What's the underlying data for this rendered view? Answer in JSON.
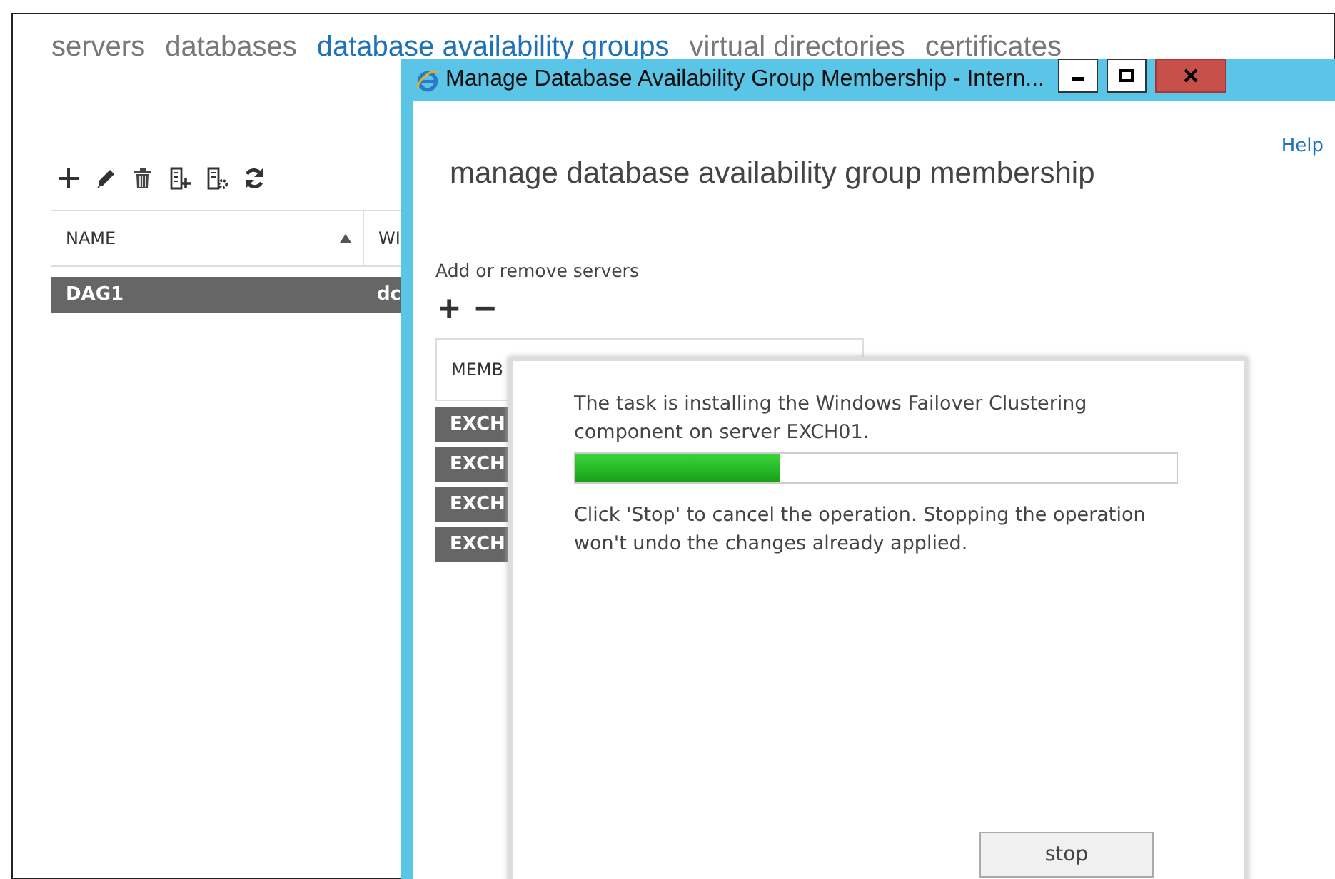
{
  "tabs": [
    {
      "label": "servers",
      "selected": false
    },
    {
      "label": "databases",
      "selected": false
    },
    {
      "label": "database availability groups",
      "selected": true
    },
    {
      "label": "virtual directories",
      "selected": false
    },
    {
      "label": "certificates",
      "selected": false
    }
  ],
  "table": {
    "columns": [
      {
        "label": "NAME",
        "sorted": true
      },
      {
        "label": "WI",
        "sorted": false
      }
    ],
    "rows": [
      {
        "cells": [
          "DAG1",
          "dc"
        ],
        "selected": true
      }
    ]
  },
  "dialog": {
    "title": "Manage Database Availability Group Membership - Intern...",
    "help": "Help",
    "heading": "manage database availability group membership",
    "section_label": "Add or remove servers",
    "add_symbol": "+",
    "remove_symbol": "−",
    "members": {
      "column": "MEMB",
      "rows": [
        {
          "label": "EXCH",
          "selected": true
        },
        {
          "label": "EXCH",
          "selected": true
        },
        {
          "label": "EXCH",
          "selected": true
        },
        {
          "label": "EXCH",
          "selected": true
        }
      ]
    },
    "progress": {
      "message": "The task is installing the Windows Failover Clustering component on server EXCH01.",
      "level": 0.34,
      "note": "Click 'Stop' to cancel the operation. Stopping the operation won't undo the changes already applied.",
      "button": "stop"
    }
  }
}
